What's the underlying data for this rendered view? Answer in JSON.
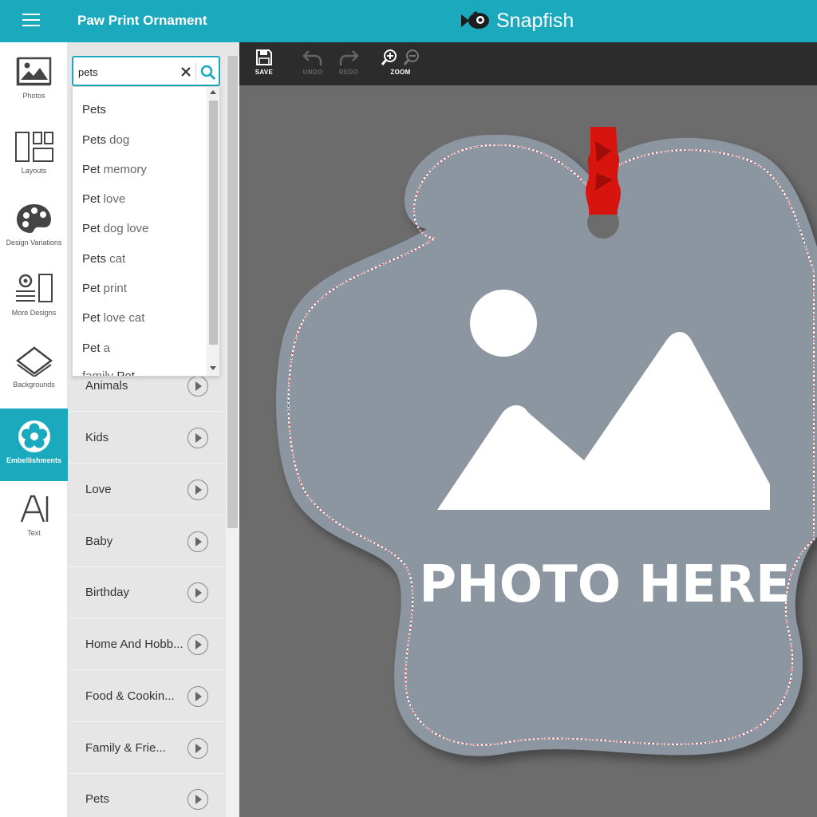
{
  "app": {
    "title": "Paw Print Ornament",
    "brand": "Snapfish",
    "accent": "#1ba9be"
  },
  "rail": {
    "photos": "Photos",
    "layouts": "Layouts",
    "design_variations": "Design Variations",
    "more_designs": "More Designs",
    "backgrounds": "Backgrounds",
    "embellishments": "Embellishments",
    "text": "Text"
  },
  "search": {
    "value": "pets",
    "suggestions": [
      {
        "bold": "Pets",
        "rest": ""
      },
      {
        "bold": "Pets",
        "rest": " dog"
      },
      {
        "bold": "Pet",
        "rest": " memory"
      },
      {
        "bold": "Pet",
        "rest": " love"
      },
      {
        "bold": "Pet",
        "rest": " dog love"
      },
      {
        "bold": "Pets",
        "rest": " cat"
      },
      {
        "bold": "Pet",
        "rest": " print"
      },
      {
        "bold": "Pet",
        "rest": " love cat"
      },
      {
        "bold": "Pet",
        "rest": " a"
      },
      {
        "bold": "family ",
        "rest": "Pet"
      }
    ]
  },
  "categories": [
    "Animals",
    "Kids",
    "Love",
    "Baby",
    "Birthday",
    "Home And Hobb...",
    "Food & Cookin...",
    "Family & Frie...",
    "Pets"
  ],
  "toolbar": {
    "save": "SAVE",
    "undo": "UNDO",
    "redo": "REDO",
    "zoom": "ZOOM"
  },
  "canvas": {
    "placeholder": "PHOTO HERE",
    "ornament_color": "#8c96a1",
    "ribbon_color": "#d8140f"
  }
}
